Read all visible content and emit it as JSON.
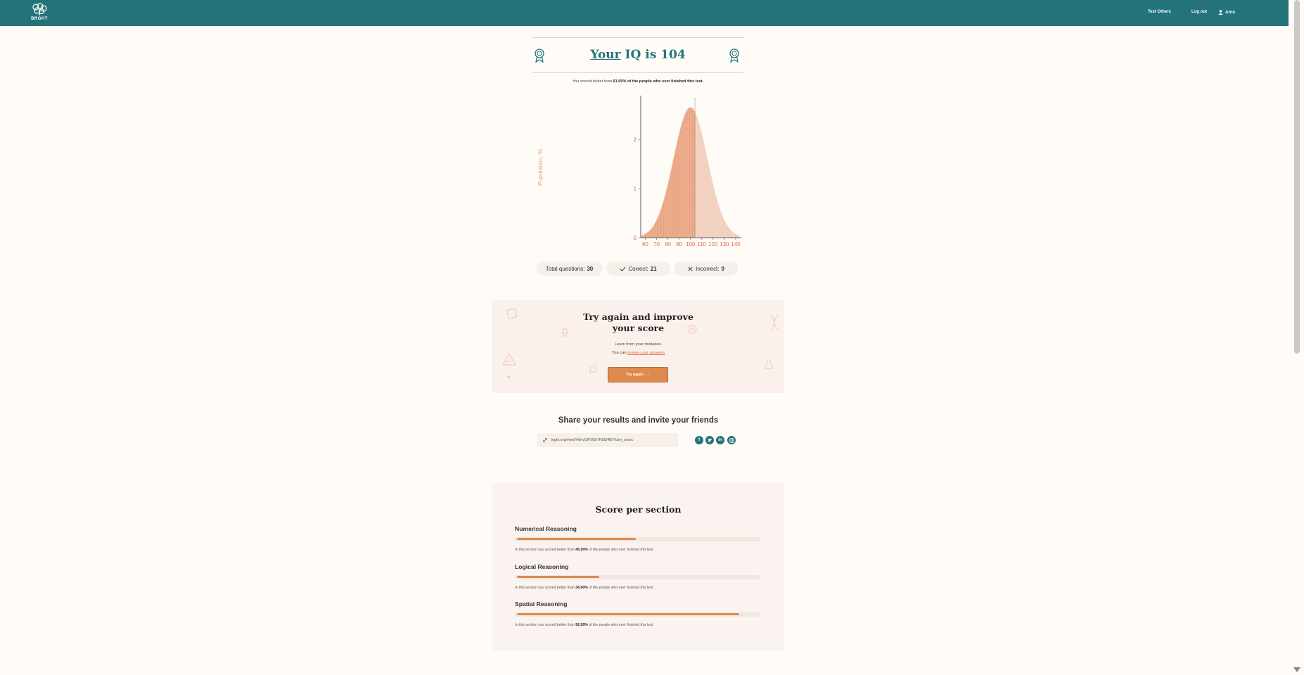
{
  "header": {
    "logo_text": "BRGHT",
    "nav": {
      "test_others": "Test Others",
      "logout": "Log out",
      "user": "Arnu"
    },
    "colors": {
      "header_bg": "#24737a"
    }
  },
  "result": {
    "title_prefix": "Your",
    "title_rest": " IQ is 104",
    "subtitle_before": "You scored better than ",
    "subtitle_pct": "61.00% of the people who ever finished this test."
  },
  "chart_data": {
    "type": "bar",
    "ylabel": "Population, %",
    "x_ticks": [
      60,
      70,
      80,
      90,
      100,
      110,
      120,
      130,
      140
    ],
    "y_ticks": [
      0,
      1,
      2
    ],
    "xlim": [
      56,
      145
    ],
    "ylim": [
      0,
      2.9
    ],
    "distribution": {
      "mean": 100,
      "sd": 15,
      "x_start": 57,
      "x_end": 143
    },
    "user_score": 104,
    "colors": {
      "below": "#e8a07c",
      "above": "#f1cdb9",
      "marker": "#888888"
    }
  },
  "stats": {
    "total_label": "Total questions:",
    "total_value": "30",
    "correct_label": "Correct:",
    "correct_value": "21",
    "incorrect_label": "Incorrect:",
    "incorrect_value": "9"
  },
  "try_again": {
    "title_line1": "Try again and improve",
    "title_line2": "your score",
    "text1": "Learn from your mistakes.",
    "text2_before": "You can ",
    "review_link": "review your answers",
    "button": "Try again",
    "button_arrow": "→"
  },
  "share": {
    "title": "Share your results and invite your friends",
    "link": "brght.org/view/V6nvCRVGk7N5lZ4l6/?utm_sourc",
    "socials": [
      "facebook-icon",
      "twitter-icon",
      "linkedin-icon",
      "instagram-icon"
    ]
  },
  "score_sections": {
    "title": "Score per section",
    "note_before": "In this section you scored better than ",
    "note_after": " of the people who ever finished this test",
    "items": [
      {
        "name": "Numerical Reasoning",
        "pct_text": "45.00%",
        "fill": 0.49
      },
      {
        "name": "Logical Reasoning",
        "pct_text": "34.00%",
        "fill": 0.34
      },
      {
        "name": "Spatial Reasoning",
        "pct_text": "92.00%",
        "fill": 0.92
      }
    ]
  }
}
